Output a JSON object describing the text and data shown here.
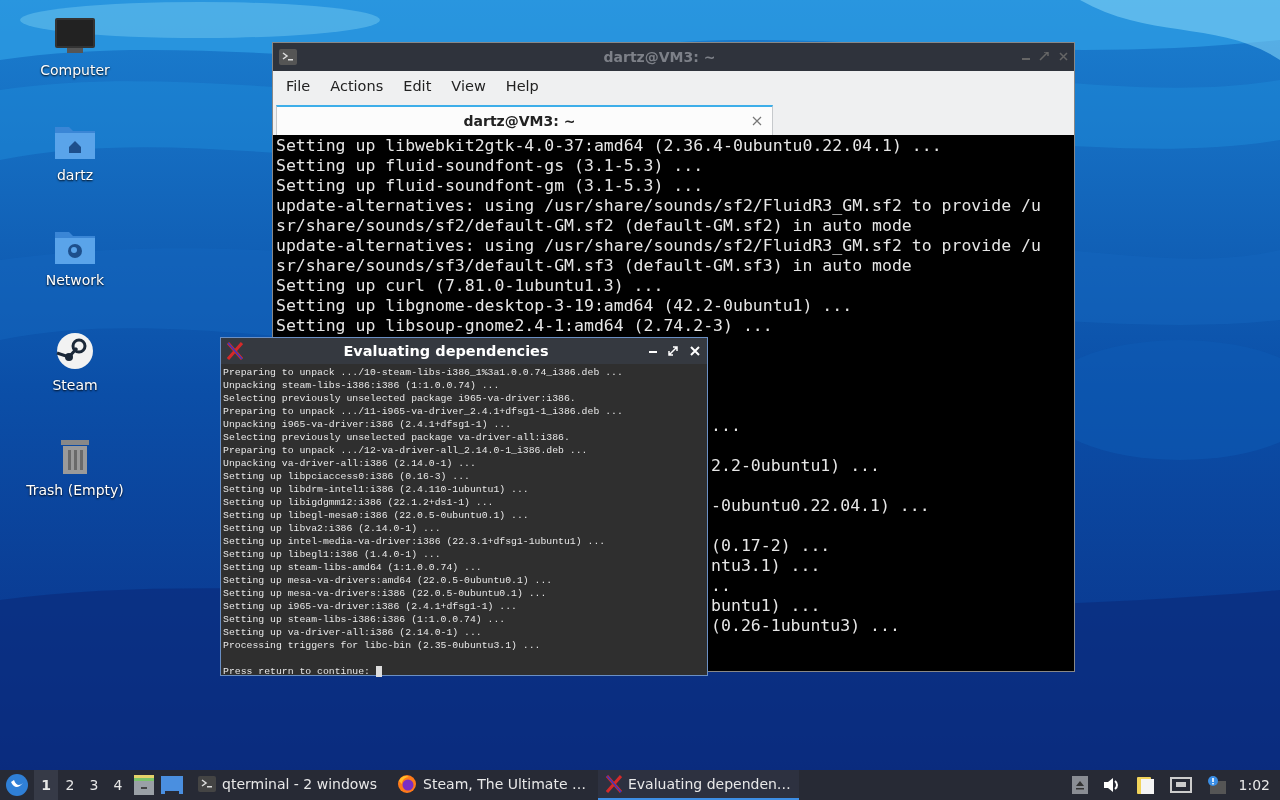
{
  "desktop_icons": [
    {
      "label": "Computer",
      "kind": "computer"
    },
    {
      "label": "dartz",
      "kind": "home"
    },
    {
      "label": "Network",
      "kind": "network"
    },
    {
      "label": "Steam",
      "kind": "steam"
    },
    {
      "label": "Trash (Empty)",
      "kind": "trash"
    }
  ],
  "terminal_window": {
    "title": "dartz@VM3: ~",
    "menu": [
      "File",
      "Actions",
      "Edit",
      "View",
      "Help"
    ],
    "tabs": [
      {
        "label": "dartz@VM3: ~",
        "selected": true
      }
    ],
    "lines": [
      {
        "kind": "full",
        "text": "Setting up libwebkit2gtk-4.0-37:amd64 (2.36.4-0ubuntu0.22.04.1) ..."
      },
      {
        "kind": "full",
        "text": "Setting up fluid-soundfont-gs (3.1-5.3) ..."
      },
      {
        "kind": "full",
        "text": "Setting up fluid-soundfont-gm (3.1-5.3) ..."
      },
      {
        "kind": "full",
        "text": "update-alternatives: using /usr/share/sounds/sf2/FluidR3_GM.sf2 to provide /u"
      },
      {
        "kind": "full",
        "text": "sr/share/sounds/sf2/default-GM.sf2 (default-GM.sf2) in auto mode"
      },
      {
        "kind": "full",
        "text": "update-alternatives: using /usr/share/sounds/sf2/FluidR3_GM.sf2 to provide /u"
      },
      {
        "kind": "full",
        "text": "sr/share/sounds/sf3/default-GM.sf3 (default-GM.sf3) in auto mode"
      },
      {
        "kind": "full",
        "text": "Setting up curl (7.81.0-1ubuntu1.3) ..."
      },
      {
        "kind": "full",
        "text": "Setting up libgnome-desktop-3-19:amd64 (42.2-0ubuntu1) ..."
      },
      {
        "kind": "full",
        "text": "Setting up libsoup-gnome2.4-1:amd64 (2.74.2-3) ..."
      },
      {
        "kind": "blank"
      },
      {
        "kind": "blank"
      },
      {
        "kind": "blank"
      },
      {
        "kind": "blank"
      },
      {
        "kind": "tail",
        "text": "..."
      },
      {
        "kind": "blank"
      },
      {
        "kind": "tail",
        "text": "2.2-0ubuntu1) ..."
      },
      {
        "kind": "blank"
      },
      {
        "kind": "tail",
        "text": "-0ubuntu0.22.04.1) ..."
      },
      {
        "kind": "blank"
      },
      {
        "kind": "tail",
        "text": "(0.17-2) ..."
      },
      {
        "kind": "tail",
        "text": "ntu3.1) ..."
      },
      {
        "kind": "tail",
        "text": ".."
      },
      {
        "kind": "tail",
        "text": "buntu1) ..."
      },
      {
        "kind": "tail",
        "text": "(0.26-1ubuntu3) ..."
      }
    ]
  },
  "xterm_window": {
    "title": "Evaluating dependencies",
    "lines": [
      "Preparing to unpack .../10-steam-libs-i386_1%3a1.0.0.74_i386.deb ...",
      "Unpacking steam-libs-i386:i386 (1:1.0.0.74) ...",
      "Selecting previously unselected package i965-va-driver:i386.",
      "Preparing to unpack .../11-i965-va-driver_2.4.1+dfsg1-1_i386.deb ...",
      "Unpacking i965-va-driver:i386 (2.4.1+dfsg1-1) ...",
      "Selecting previously unselected package va-driver-all:i386.",
      "Preparing to unpack .../12-va-driver-all_2.14.0-1_i386.deb ...",
      "Unpacking va-driver-all:i386 (2.14.0-1) ...",
      "Setting up libpciaccess0:i386 (0.16-3) ...",
      "Setting up libdrm-intel1:i386 (2.4.110-1ubuntu1) ...",
      "Setting up libigdgmm12:i386 (22.1.2+ds1-1) ...",
      "Setting up libegl-mesa0:i386 (22.0.5-0ubuntu0.1) ...",
      "Setting up libva2:i386 (2.14.0-1) ...",
      "Setting up intel-media-va-driver:i386 (22.3.1+dfsg1-1ubuntu1) ...",
      "Setting up libegl1:i386 (1.4.0-1) ...",
      "Setting up steam-libs-amd64 (1:1.0.0.74) ...",
      "Setting up mesa-va-drivers:amd64 (22.0.5-0ubuntu0.1) ...",
      "Setting up mesa-va-drivers:i386 (22.0.5-0ubuntu0.1) ...",
      "Setting up i965-va-driver:i386 (2.4.1+dfsg1-1) ...",
      "Setting up steam-libs-i386:i386 (1:1.0.0.74) ...",
      "Setting up va-driver-all:i386 (2.14.0-1) ...",
      "Processing triggers for libc-bin (2.35-0ubuntu3.1) ..."
    ],
    "prompt": "Press return to continue:"
  },
  "taskbar": {
    "workspaces": [
      {
        "label": "1",
        "selected": true
      },
      {
        "label": "2",
        "selected": false
      },
      {
        "label": "3",
        "selected": false
      },
      {
        "label": "4",
        "selected": false
      }
    ],
    "tasks": [
      {
        "label": "qterminal - 2 windows",
        "kind": "terminal",
        "selected": false
      },
      {
        "label": "Steam, The Ultimate …",
        "kind": "firefox",
        "selected": false
      },
      {
        "label": "Evaluating dependen…",
        "kind": "xterm",
        "selected": true
      }
    ],
    "clock": "1:02"
  }
}
